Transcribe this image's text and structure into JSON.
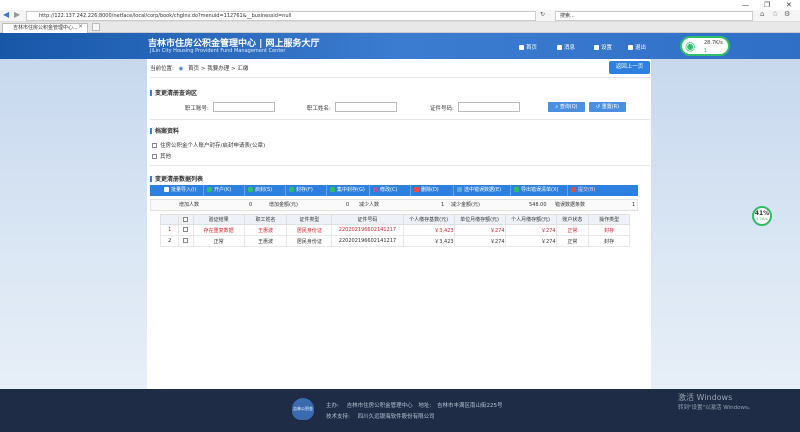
{
  "browser": {
    "url": "http://122.137.242.226:8000/netface/local/corp/book/chgInv.do?menuid=112761&__businessid=null",
    "search_placeholder": "搜索...",
    "tab_title": "吉林市住房公积金管理中心..."
  },
  "header": {
    "title": "吉林市住房公积金管理中心 | 网上服务大厅",
    "subtitle": "JiLin City Housing Provident Fund Management Center",
    "nav": [
      "首页",
      "消息",
      "设置",
      "退出"
    ]
  },
  "net_widget": {
    "speed": "28.7K/s",
    "value": "1"
  },
  "breadcrumb": {
    "label": "当前位置:",
    "path": "首页 > 我要办理 > 汇缴"
  },
  "back_button": "返回上一页",
  "query": {
    "section": "变更清册查询区",
    "emp_no_label": "职工账号:",
    "emp_name_label": "职工姓名:",
    "id_no_label": "证件号码:",
    "query_btn": "查询(Q)",
    "reset_btn": "重置(R)"
  },
  "materials": {
    "section": "档案资料",
    "items": [
      "住房公积金个人账户封存/启封申请表(公章)",
      "其他"
    ]
  },
  "list": {
    "section": "变更清册数据列表",
    "toolbar": [
      "批量导入(I)",
      "开户(K)",
      "启封(S)",
      "封存(F)",
      "集中封存(G)",
      "修改(C)",
      "删除(D)",
      "选中错误数据(E)",
      "导出错误清单(X)",
      "提交(B)"
    ],
    "toolbar_colors": [
      "#ffffff",
      "#2fbe6a",
      "#2fbe6a",
      "#2fbe6a",
      "#2fbe6a",
      "#9b59b6",
      "#e74c3c",
      "#5dade2",
      "#2fbe6a",
      "#e74c3c"
    ],
    "stats": {
      "add_count_label": "增加人数",
      "add_count": "0",
      "add_amount_label": "增加金额(元)",
      "add_amount": "0",
      "reduce_count_label": "减少人数",
      "reduce_count": "1",
      "reduce_amount_label": "减少金额(元)",
      "reduce_amount": "548.00",
      "error_count_label": "错误数据条数",
      "error_count": "1"
    },
    "columns": [
      "",
      "",
      "验证结果",
      "职工姓名",
      "证件类型",
      "证件号码",
      "个人缴存基数(元)",
      "单位月缴存额(元)",
      "个人月缴存额(元)",
      "账户状态",
      "操作类型"
    ],
    "rows": [
      {
        "no": "1",
        "result": "存在重复数据",
        "name": "王惠波",
        "id_type": "居民身份证",
        "id_no": "220202196602141217",
        "base": "￥3,423",
        "unit": "￥274",
        "personal": "￥274",
        "status": "正常",
        "op": "封存",
        "error": true
      },
      {
        "no": "2",
        "result": "正常",
        "name": "王惠波",
        "id_type": "居民身份证",
        "id_no": "220202196602141217",
        "base": "￥3,423",
        "unit": "￥274",
        "personal": "￥274",
        "status": "正常",
        "op": "封存",
        "error": false
      }
    ]
  },
  "gauge": {
    "percent": "41%",
    "speed": "1.2K/s"
  },
  "footer": {
    "host_label": "主办:",
    "host": "吉林市住房公积金管理中心",
    "addr_label": "地址:",
    "addr": "吉林市丰满区南山街225号",
    "tech_label": "技术支持:",
    "tech": "四川久远银海软件股份有限公司",
    "logo": "吉林公积金"
  },
  "watermark": {
    "line1": "激活 Windows",
    "line2": "转到\"设置\"以激活 Windows。"
  }
}
